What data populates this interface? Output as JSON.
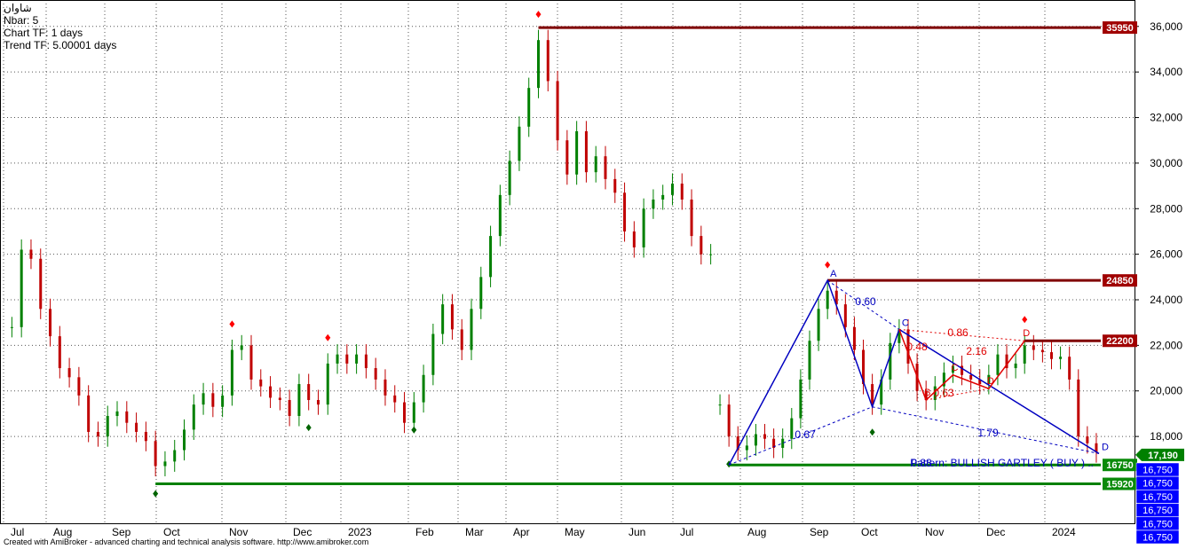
{
  "header": {
    "symbol": "شاوان",
    "nbar": "Nbar: 5",
    "chart_tf": "Chart TF: 1 days",
    "trend_tf": "Trend TF: 5.00001 days"
  },
  "footer": {
    "credit": "Created with AmiBroker - advanced charting and technical analysis software. http://www.amibroker.com"
  },
  "colors": {
    "up": "#008000",
    "down": "#c00000",
    "resistance": "#800000",
    "support": "#008000",
    "pattern": "#0000c0",
    "projection": "#e00000",
    "price_box": "#008000",
    "level_box": "#0000ff"
  },
  "chart_data": {
    "type": "candlestick",
    "y_axis": {
      "min": 16000,
      "max": 36000,
      "ticks": [
        18000,
        20000,
        22000,
        24000,
        26000,
        28000,
        30000,
        32000,
        34000,
        36000
      ],
      "position": "right"
    },
    "x_axis": {
      "labels": [
        "Jul",
        "Aug",
        "Sep",
        "Oct",
        "Nov",
        "Dec",
        "2023",
        "Feb",
        "Mar",
        "Apr",
        "May",
        "Jun",
        "Jul",
        "Aug",
        "Sep",
        "Oct",
        "Nov",
        "Dec",
        "2024"
      ]
    },
    "grid": true,
    "price_segments": [
      {
        "start": "Jul",
        "end": "Jul",
        "points": [
          [
            "Jul",
            22800
          ],
          [
            "Jul",
            26200
          ],
          [
            "Jul",
            25800
          ],
          [
            "Jul",
            23600
          ],
          [
            "Jul",
            22400
          ],
          [
            "Aug",
            21000
          ],
          [
            "Aug",
            20600
          ],
          [
            "Aug",
            19800
          ],
          [
            "Aug",
            18200
          ],
          [
            "Aug",
            18000
          ],
          [
            "Aug",
            18900
          ],
          [
            "Aug",
            19100
          ],
          [
            "Sep",
            18600
          ],
          [
            "Sep",
            18200
          ],
          [
            "Sep",
            17800
          ],
          [
            "Sep",
            16700
          ],
          [
            "Sep",
            16900
          ],
          [
            "Oct",
            17400
          ],
          [
            "Oct",
            18300
          ],
          [
            "Oct",
            19400
          ],
          [
            "Oct",
            19900
          ],
          [
            "Oct",
            19300
          ],
          [
            "Nov",
            19800
          ],
          [
            "Nov",
            21800
          ],
          [
            "Nov",
            22000
          ],
          [
            "Nov",
            20500
          ],
          [
            "Nov",
            20200
          ],
          [
            "Dec",
            19700
          ],
          [
            "Dec",
            19600
          ],
          [
            "Dec",
            18900
          ],
          [
            "Dec",
            20300
          ],
          [
            "Dec",
            19600
          ],
          [
            "Dec",
            19400
          ],
          [
            "2023",
            21200
          ],
          [
            "2023",
            21600
          ],
          [
            "2023",
            21200
          ],
          [
            "2023",
            21600
          ],
          [
            "2023",
            21000
          ],
          [
            "2023",
            20500
          ],
          [
            "Feb",
            19800
          ],
          [
            "Feb",
            19500
          ],
          [
            "Feb",
            18600
          ],
          [
            "Feb",
            19500
          ],
          [
            "Feb",
            20700
          ],
          [
            "Mar",
            22500
          ],
          [
            "Mar",
            23800
          ],
          [
            "Mar",
            22700
          ],
          [
            "Mar",
            21800
          ],
          [
            "Mar",
            23600
          ],
          [
            "Mar",
            25000
          ],
          [
            "Apr",
            26800
          ],
          [
            "Apr",
            28600
          ],
          [
            "Apr",
            30100
          ],
          [
            "Apr",
            31600
          ],
          [
            "Apr",
            33300
          ],
          [
            "May",
            35400
          ],
          [
            "May",
            33600
          ],
          [
            "May",
            31000
          ],
          [
            "May",
            29500
          ],
          [
            "May",
            31400
          ],
          [
            "May",
            29600
          ],
          [
            "Jun",
            30300
          ],
          [
            "Jun",
            29300
          ],
          [
            "Jun",
            28700
          ],
          [
            "Jun",
            27000
          ],
          [
            "Jun",
            26300
          ],
          [
            "Jun",
            28000
          ],
          [
            "Jul",
            28400
          ],
          [
            "Jul",
            28600
          ],
          [
            "Jul",
            29100
          ],
          [
            "Jul",
            28400
          ],
          [
            "Jul",
            26800
          ],
          [
            "Jul",
            26000
          ],
          [
            "Jul",
            26000
          ]
        ]
      },
      {
        "start": "Aug",
        "end": "2024",
        "points": [
          [
            "Aug",
            19400
          ],
          [
            "Aug",
            18000
          ],
          [
            "Aug",
            17400
          ],
          [
            "Aug",
            17600
          ],
          [
            "Aug",
            18100
          ],
          [
            "Aug",
            17900
          ],
          [
            "Aug",
            17500
          ],
          [
            "Aug",
            17900
          ],
          [
            "Sep",
            18800
          ],
          [
            "Sep",
            20500
          ],
          [
            "Sep",
            22200
          ],
          [
            "Sep",
            23600
          ],
          [
            "Sep",
            24400
          ],
          [
            "Sep",
            23800
          ],
          [
            "Sep",
            22800
          ],
          [
            "Oct",
            21800
          ],
          [
            "Oct",
            20300
          ],
          [
            "Oct",
            19400
          ],
          [
            "Oct",
            20500
          ],
          [
            "Oct",
            22100
          ],
          [
            "Oct",
            22700
          ],
          [
            "Nov",
            21200
          ],
          [
            "Nov",
            20000
          ],
          [
            "Nov",
            19600
          ],
          [
            "Nov",
            20200
          ],
          [
            "Nov",
            20800
          ],
          [
            "Nov",
            21100
          ],
          [
            "Nov",
            20700
          ],
          [
            "Dec",
            20500
          ],
          [
            "Dec",
            20300
          ],
          [
            "Dec",
            20700
          ],
          [
            "Dec",
            21600
          ],
          [
            "Dec",
            21000
          ],
          [
            "Dec",
            21200
          ],
          [
            "Dec",
            22000
          ],
          [
            "2024",
            21800
          ],
          [
            "2024",
            21700
          ],
          [
            "2024",
            21400
          ],
          [
            "2024",
            21500
          ],
          [
            "2024",
            20500
          ],
          [
            "2024",
            18000
          ],
          [
            "2024",
            17700
          ],
          [
            "2024",
            17300
          ]
        ]
      }
    ],
    "horizontal_levels": [
      {
        "value": 35950,
        "label": "35950",
        "kind": "resistance"
      },
      {
        "value": 24850,
        "label": "24850",
        "kind": "resistance"
      },
      {
        "value": 22200,
        "label": "22200",
        "kind": "resistance"
      },
      {
        "value": 16750,
        "label": "16750",
        "kind": "support"
      },
      {
        "value": 15920,
        "label": "15920",
        "kind": "support"
      }
    ],
    "last_price": {
      "value": 17190,
      "label": "17,190"
    },
    "level_stack": {
      "label": "16,750",
      "count": 6
    },
    "harmonic_pattern": {
      "label": "Pattern: BULLISH GARTLEY ( BUY ) ..",
      "points": [
        {
          "name": "X",
          "value": 16750
        },
        {
          "name": "A",
          "value": 24850,
          "label": "A"
        },
        {
          "name": "B",
          "value": 19300
        },
        {
          "name": "C",
          "value": 22700,
          "label": "C"
        },
        {
          "name": "D",
          "value": 17250,
          "label": "D"
        }
      ],
      "ratios": [
        {
          "label": "0.60",
          "color": "pattern"
        },
        {
          "label": "0.67",
          "color": "pattern"
        },
        {
          "label": "1.79",
          "color": "pattern"
        },
        {
          "label": "0.88",
          "color": "pattern"
        }
      ]
    },
    "projected_pattern": {
      "points": [
        {
          "name": "C",
          "value": 22700
        },
        {
          "name": "B",
          "value": 19600,
          "label": "B"
        },
        {
          "name": "C2",
          "value": 20700,
          "label": "C"
        },
        {
          "name": "D",
          "value": 20100,
          "label": "D"
        },
        {
          "name": "E",
          "value": 22200,
          "label": "D"
        }
      ],
      "ratios": [
        {
          "label": "0.48"
        },
        {
          "label": "0.86"
        },
        {
          "label": "2.16"
        },
        {
          "label": "0.63"
        }
      ]
    }
  }
}
